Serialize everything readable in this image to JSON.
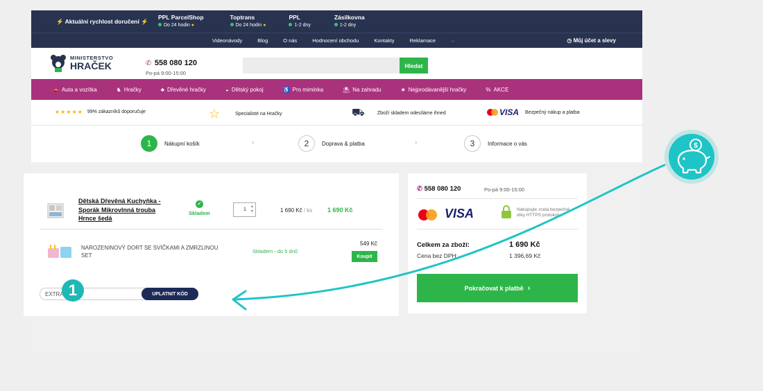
{
  "topbar": {
    "delivery_label": "Aktuální rychlost doručení",
    "carriers": [
      {
        "name": "PPL ParcelShop",
        "time": "Do 24 hodin"
      },
      {
        "name": "Toptrans",
        "time": "Do 24 hodin"
      },
      {
        "name": "PPL",
        "time": "1-2 dny"
      },
      {
        "name": "Zásilkovna",
        "time": "1-2 dny"
      }
    ]
  },
  "nav": {
    "links": [
      "Videonávody",
      "Blog",
      "O nás",
      "Hodnocení obchodu",
      "Kontakty",
      "Reklamace"
    ],
    "account": "Můj účet a slevy"
  },
  "header": {
    "logo_top": "MINISTERSTVO",
    "logo_bottom": "HRAČEK",
    "phone": "558 080 120",
    "hours": "Po-pá 9:00-15:00",
    "search_button": "Hledat"
  },
  "categories": [
    "Auta a vozítka",
    "Hračky",
    "Dřevěné hračky",
    "Dětský pokoj",
    "Pro miminka",
    "Na zahradu",
    "Nejprodávanější hračky",
    "AKCE"
  ],
  "usp": {
    "rating_text": "99% zákazníků doporučuje",
    "specialist": "Specialisté na Hračky",
    "stock": "Zboží skladem odesíláme ihned",
    "visa": "VISA",
    "payment": "Bezpečný nákup a platba"
  },
  "steps": [
    {
      "num": "1",
      "label": "Nákupní košík"
    },
    {
      "num": "2",
      "label": "Doprava & platba"
    },
    {
      "num": "3",
      "label": "Informace o vás"
    }
  ],
  "cart": {
    "item1": {
      "line1": "Dětská Dřevěná Kuchyňka -",
      "line2": "Sporák Mikrovlnná trouba",
      "line3": "Hrnce šedá",
      "stock": "Skladem",
      "qty": "1",
      "unit_price": "1 690 Kč",
      "per_unit": "/ ks",
      "total": "1 690 Kč"
    },
    "item2": {
      "line1": "NAROZENINOVÝ DORT SE SVÍČKAMI A ZMRZLINOU",
      "line2": "SET",
      "stock": "Skladem - do 5 dnů",
      "price": "549 Kč",
      "buy": "Koupit"
    },
    "coupon_value": "EXTRA30",
    "apply_label": "UPLATNIT KÓD"
  },
  "summary": {
    "phone": "558 080 120",
    "hours": "Po-pá 9:00-15:00",
    "visa": "VISA",
    "secure_line1": "Nakupujte zcela bezpečně",
    "secure_line2": "díky HTTPS protokolu.",
    "total_label": "Celkem za zboží:",
    "total_value": "1 690 Kč",
    "net_label": "Cena bez DPH:",
    "net_value": "1 396,69 Kč",
    "continue_label": "Pokračovat k platbě"
  },
  "annotation": {
    "badge": "1"
  }
}
